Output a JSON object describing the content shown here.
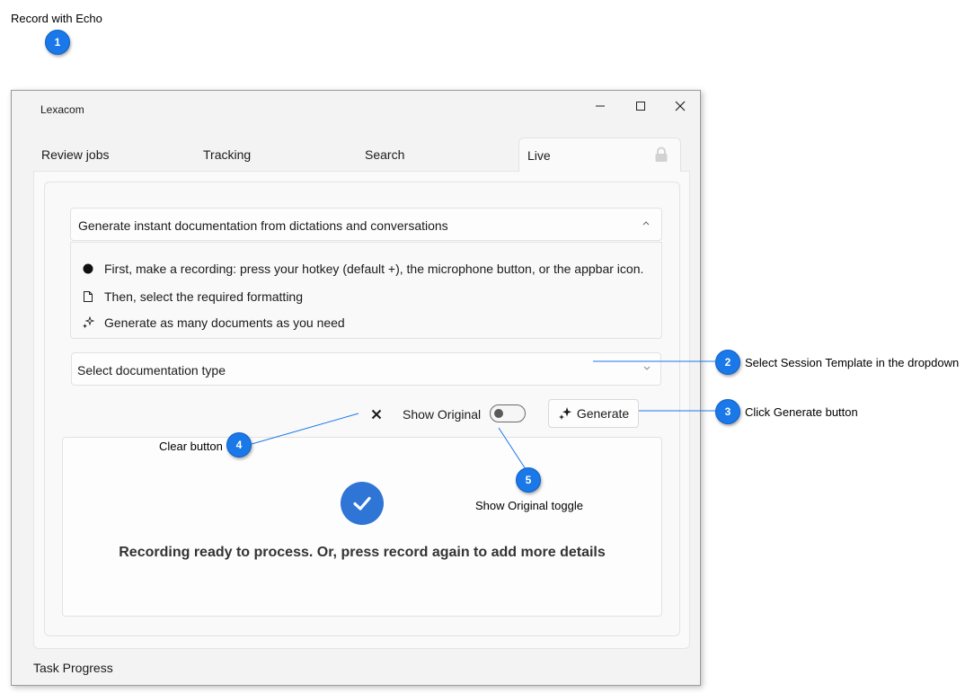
{
  "heading": "Record with Echo",
  "window": {
    "title": "Lexacom",
    "controls": {
      "minimize_icon": "minimize-icon",
      "maximize_icon": "maximize-icon",
      "close_icon": "close-icon"
    }
  },
  "tabs": [
    {
      "label": "Review jobs"
    },
    {
      "label": "Tracking"
    },
    {
      "label": "Search"
    },
    {
      "label": "Live",
      "selected": true,
      "icon": "lock-icon"
    }
  ],
  "expander": {
    "header": "Generate instant documentation from dictations and conversations",
    "expanded": true,
    "steps": [
      {
        "icon": "dot-icon",
        "text": "First, make a recording: press your hotkey (default +), the microphone button, or the appbar icon."
      },
      {
        "icon": "document-icon",
        "text": "Then, select the required formatting"
      },
      {
        "icon": "sparkle-icon",
        "text": "Generate as many documents as you need"
      }
    ]
  },
  "documentation_dropdown": {
    "placeholder": "Select documentation type"
  },
  "actions": {
    "clear_icon": "close-icon",
    "show_original_label": "Show Original",
    "show_original_on": false,
    "generate_label": "Generate",
    "generate_icon": "sparkle-icon"
  },
  "result": {
    "icon": "check-circle-icon",
    "message": "Recording ready to process. Or, press record again to add more details"
  },
  "footer": {
    "task_progress": "Task Progress"
  },
  "callouts": [
    {
      "number": "1",
      "text": ""
    },
    {
      "number": "2",
      "text": "Select Session Template in the dropdown"
    },
    {
      "number": "3",
      "text": "Click Generate button"
    },
    {
      "number": "4",
      "text": "Clear button"
    },
    {
      "number": "5",
      "text": "Show Original toggle"
    }
  ],
  "colors": {
    "badge": "#1a78e8",
    "check_circle": "#2f75d6",
    "callout_line": "#1a78e8"
  }
}
